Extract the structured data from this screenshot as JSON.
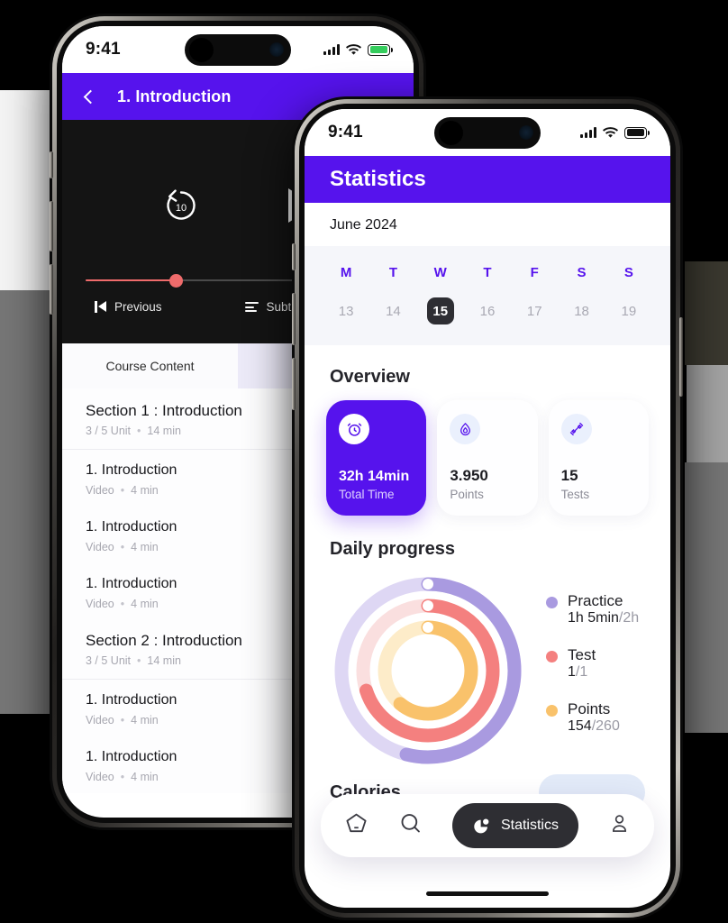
{
  "colors": {
    "brand_purple": "#5613ed",
    "dark_chip": "#2e2e33",
    "ring_practice": "#a99ae0",
    "ring_test": "#f4807f",
    "ring_points": "#f9c26b",
    "battery_left": "#35cd5d"
  },
  "left_phone": {
    "status_bar": {
      "time": "9:41",
      "signal_icon": "cellular-bars-icon",
      "wifi_icon": "wifi-icon",
      "battery_icon": "battery-icon"
    },
    "appbar": {
      "back_icon": "chevron-left-icon",
      "title": "1. Introduction"
    },
    "player": {
      "replay_icon": "replay-10-icon",
      "replay_label": "10",
      "play_icon": "play-icon",
      "progress_percent": 29,
      "previous_label": "Previous",
      "previous_icon": "skip-previous-icon",
      "subtitle_label": "Subtitle",
      "subtitle_icon": "subtitle-icon"
    },
    "tabs": [
      {
        "label": "Course Content",
        "active": true
      },
      {
        "label": "",
        "active": false
      }
    ],
    "list": [
      {
        "type": "section",
        "title": "Section 1 : Introduction",
        "units": "3 / 5 Unit",
        "duration": "14 min"
      },
      {
        "type": "unit",
        "title": "1. Introduction",
        "kind": "Video",
        "duration": "4 min"
      },
      {
        "type": "unit",
        "title": "1. Introduction",
        "kind": "Video",
        "duration": "4 min"
      },
      {
        "type": "unit",
        "title": "1. Introduction",
        "kind": "Video",
        "duration": "4 min"
      },
      {
        "type": "section",
        "title": "Section 2 : Introduction",
        "units": "3 / 5 Unit",
        "duration": "14 min"
      },
      {
        "type": "unit",
        "title": "1. Introduction",
        "kind": "Video",
        "duration": "4 min"
      },
      {
        "type": "unit",
        "title": "1. Introduction",
        "kind": "Video",
        "duration": "4 min"
      }
    ],
    "separator": "•"
  },
  "right_phone": {
    "status_bar": {
      "time": "9:41",
      "signal_icon": "cellular-bars-icon",
      "wifi_icon": "wifi-icon",
      "battery_icon": "battery-icon"
    },
    "appbar": {
      "title": "Statistics"
    },
    "calendar": {
      "month": "June 2024",
      "days_of_week": [
        "M",
        "T",
        "W",
        "T",
        "F",
        "S",
        "S"
      ],
      "dates": [
        "13",
        "14",
        "15",
        "16",
        "17",
        "18",
        "19"
      ],
      "selected_index": 2
    },
    "overview": {
      "title": "Overview",
      "cards": [
        {
          "icon": "alarm-clock-icon",
          "value": "32h 14min",
          "label": "Total Time",
          "highlighted": true
        },
        {
          "icon": "flame-drop-icon",
          "value": "3.950",
          "label": "Points",
          "highlighted": false
        },
        {
          "icon": "dumbbell-icon",
          "value": "15",
          "label": "Tests",
          "highlighted": false
        }
      ]
    },
    "daily_progress": {
      "title": "Daily progress",
      "legend": [
        {
          "name": "Practice",
          "value": "1h 5min",
          "denominator": "/2h",
          "color": "#a99ae0"
        },
        {
          "name": "Test",
          "value": "1",
          "denominator": "/1",
          "color": "#f4807f"
        },
        {
          "name": "Points",
          "value": "154",
          "denominator": "/260",
          "color": "#f9c26b"
        }
      ]
    },
    "calories": {
      "title": "Calories"
    },
    "bottom_nav": {
      "items": [
        {
          "icon": "home-pentagon-icon",
          "label": "",
          "active": false
        },
        {
          "icon": "search-icon",
          "label": "",
          "active": false
        },
        {
          "icon": "statistics-pie-icon",
          "label": "Statistics",
          "active": true
        },
        {
          "icon": "profile-icon",
          "label": "",
          "active": false
        }
      ]
    }
  },
  "chart_data": {
    "type": "pie",
    "title": "Daily progress",
    "subtitle": "",
    "rings": [
      {
        "name": "Practice",
        "value": 65,
        "max": 120,
        "unit": "min",
        "display": "1h 5min/2h",
        "percent": 54,
        "color": "#a99ae0",
        "track": "#ded7f4",
        "radius": 96
      },
      {
        "name": "Test",
        "value": 1,
        "max": 1,
        "unit": "tests",
        "display": "1/1",
        "percent": 70,
        "color": "#f4807f",
        "track": "#fadfdf",
        "radius": 72
      },
      {
        "name": "Points",
        "value": 154,
        "max": 260,
        "unit": "points",
        "display": "154/260",
        "percent": 61,
        "color": "#f9c26b",
        "track": "#fdecc9",
        "radius": 48
      }
    ],
    "legend_position": "right"
  }
}
